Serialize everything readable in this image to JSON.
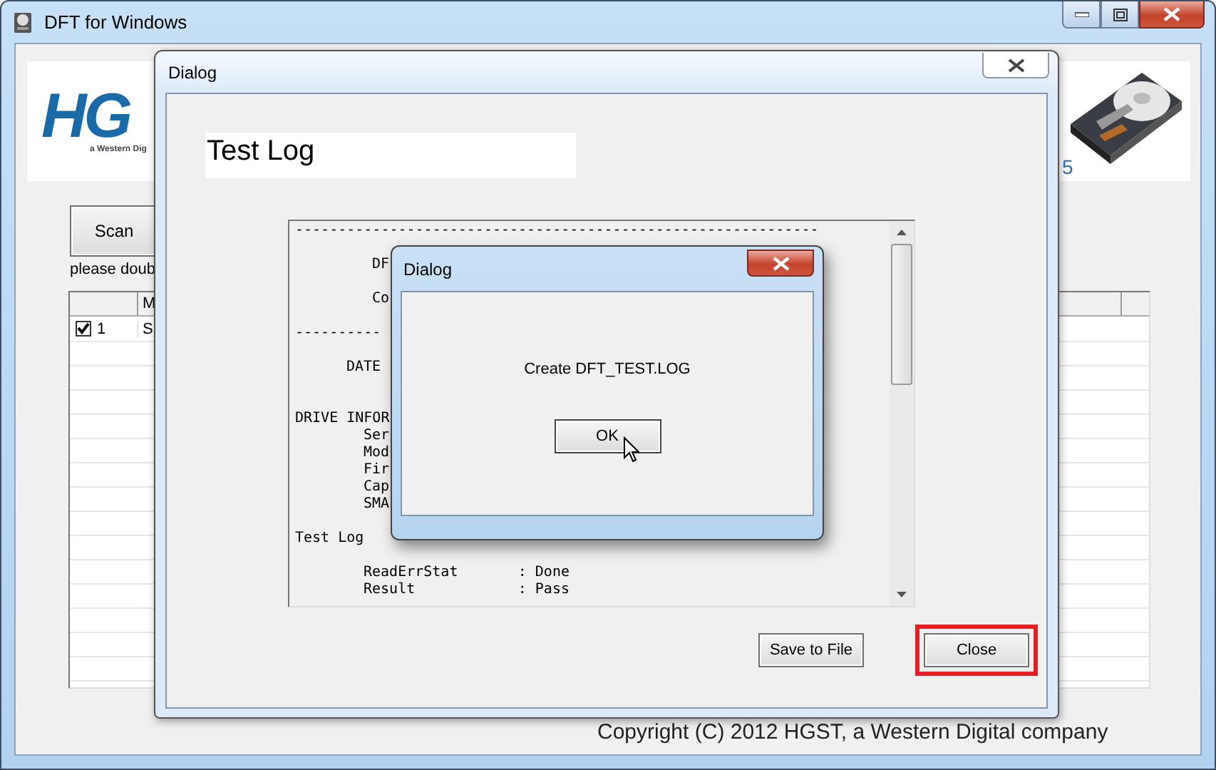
{
  "window": {
    "title": "DFT for Windows"
  },
  "main": {
    "logo": {
      "text": "HG",
      "tagline": "a Western Dig"
    },
    "scan_button": "Scan",
    "hint": "please doub",
    "fragment": "5",
    "table": {
      "columns": [
        "",
        "M"
      ],
      "rows": [
        {
          "checked": true,
          "number": "1",
          "column_3": "S"
        }
      ]
    },
    "copyright": "Copyright (C) 2012 HGST, a Western Digital company"
  },
  "dialog": {
    "title": "Dialog",
    "heading": "Test Log",
    "log": [
      {
        "lines": [
          {
            "kind": "plain",
            "text": "-------------------------------------------------------------"
          }
        ]
      },
      {
        "lines": [
          {
            "kind": "title",
            "text": "DF"
          }
        ]
      },
      {
        "lines": [
          {
            "kind": "title",
            "text": "Co"
          }
        ]
      },
      {
        "lines": [
          {
            "kind": "plain",
            "text": "----------"
          }
        ]
      },
      {
        "lines": [
          {
            "kind": "field",
            "text": "DATE"
          }
        ]
      },
      {
        "lines": [
          {
            "kind": "plain",
            "text": "DRIVE INFOR"
          },
          {
            "kind": "item",
            "text": "Ser"
          },
          {
            "kind": "item",
            "text": "Mod"
          },
          {
            "kind": "item",
            "text": "Fir"
          },
          {
            "kind": "item",
            "text": "Cap"
          },
          {
            "kind": "item",
            "text": "SMA"
          }
        ]
      },
      {
        "lines": [
          {
            "kind": "plain",
            "text": "Test Log"
          }
        ]
      },
      {
        "lines": [
          {
            "kind": "item",
            "text": "ReadErrStat       : Done"
          },
          {
            "kind": "item",
            "text": "Result            : Pass"
          }
        ]
      }
    ],
    "buttons": [
      {
        "label": "Save to File",
        "highlighted": false
      },
      {
        "label": "Close",
        "highlighted": true
      }
    ]
  },
  "message_box": {
    "title": "Dialog",
    "message": "Create DFT_TEST.LOG",
    "button": "OK"
  }
}
